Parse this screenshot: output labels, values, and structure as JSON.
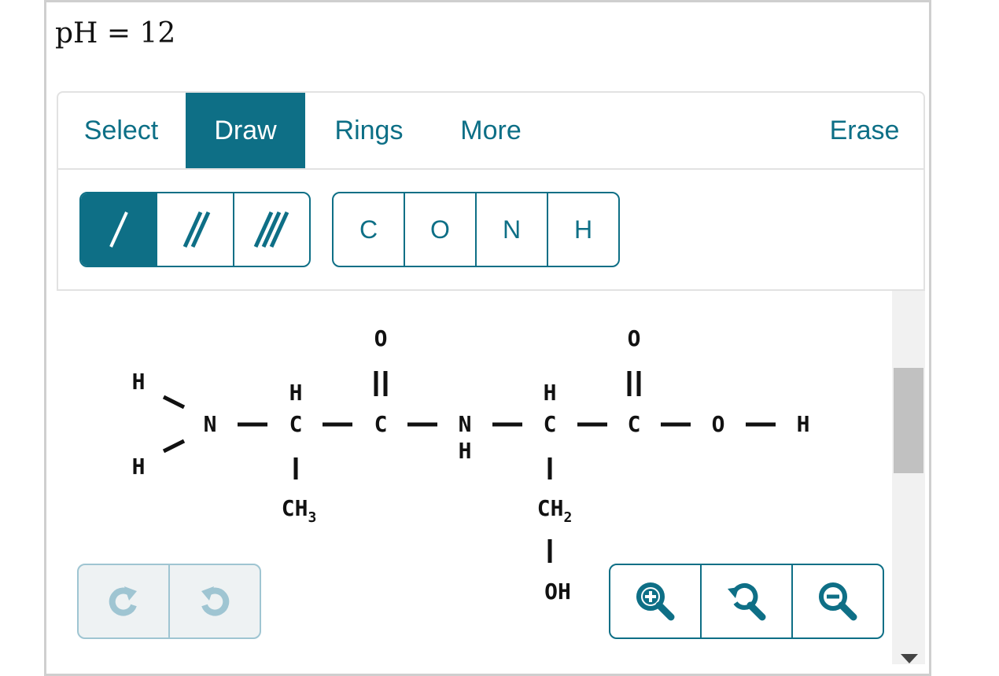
{
  "header": {
    "formula": "pH = 12"
  },
  "tabs": [
    {
      "label": "Select",
      "active": false
    },
    {
      "label": "Draw",
      "active": true
    },
    {
      "label": "Rings",
      "active": false
    },
    {
      "label": "More",
      "active": false
    },
    {
      "label": "Erase",
      "active": false
    }
  ],
  "bond_tools": [
    {
      "name": "single-bond",
      "active": true
    },
    {
      "name": "double-bond",
      "active": false
    },
    {
      "name": "triple-bond",
      "active": false
    }
  ],
  "elements": [
    "C",
    "O",
    "N",
    "H"
  ],
  "molecule": {
    "atoms": {
      "h_top": "H",
      "h_bottom": "H",
      "n1": "N",
      "h_ca1": "H",
      "ca1": "C",
      "ch3": "CH",
      "ch3_sub": "3",
      "o1": "O",
      "c1": "C",
      "n2": "N",
      "h_n2": "H",
      "h_ca2": "H",
      "ca2": "C",
      "ch2": "CH",
      "ch2_sub": "2",
      "oh": "OH",
      "o2": "O",
      "c2": "C",
      "o3": "O",
      "h_end": "H"
    }
  },
  "undo_controls": [
    "redo-icon",
    "undo-icon"
  ],
  "zoom_controls": [
    "zoom-in-icon",
    "zoom-reset-icon",
    "zoom-out-icon"
  ],
  "colors": {
    "accent": "#0e6f86",
    "disabled": "#9fc5d2"
  }
}
